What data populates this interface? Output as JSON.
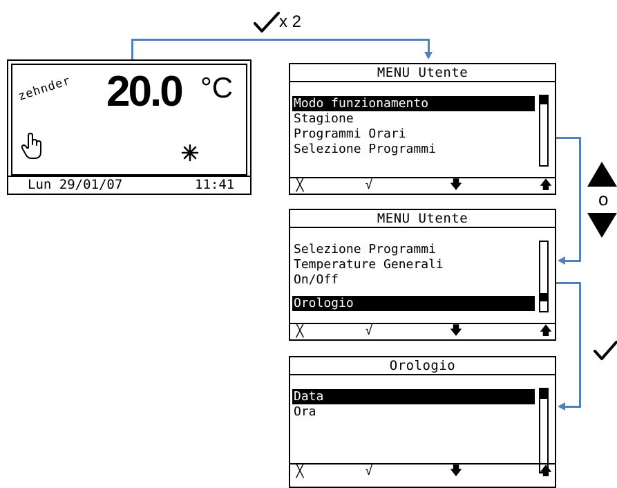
{
  "top_step": {
    "label": "x 2"
  },
  "home": {
    "brand": "zehnder",
    "temperature": "20.0",
    "unit": "°C",
    "date": "Lun 29/01/07",
    "time": "11:41"
  },
  "menu1": {
    "title": "MENU Utente",
    "items": [
      "Modo funzionamento",
      "Stagione",
      "Programmi Orari",
      "Selezione Programmi"
    ],
    "selected": 0
  },
  "menu2": {
    "title": "MENU Utente",
    "items": [
      "Selezione Programmi",
      "Temperature Generali",
      "On/Off",
      "Orologio"
    ],
    "selected": 3
  },
  "menu3": {
    "title": "Orologio",
    "items": [
      "Data",
      "Ora"
    ],
    "selected": 0
  },
  "side_nav": {
    "or_label": "o"
  },
  "softkeys": {
    "cancel": "╳",
    "confirm": "√",
    "down": "🡇",
    "up": "🡅"
  },
  "colors": {
    "connector": "#4f81bd",
    "lcd_fg": "#000000",
    "lcd_bg": "#ffffff"
  }
}
